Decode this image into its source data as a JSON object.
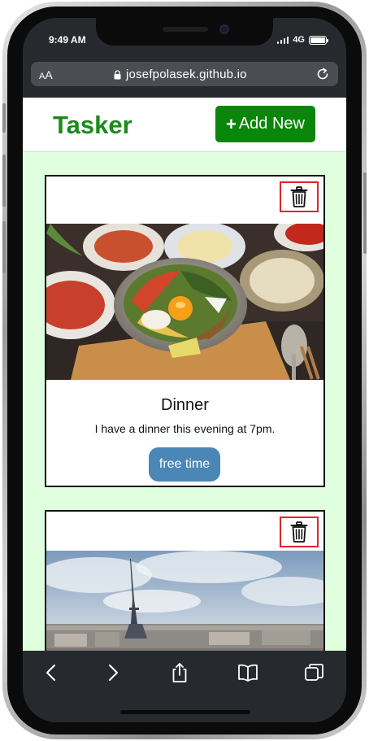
{
  "status_bar": {
    "time": "9:49 AM",
    "network": "4G",
    "battery_level": 1.0
  },
  "browser": {
    "text_size_label": "AA",
    "url": "josefpolasek.github.io"
  },
  "app": {
    "brand": "Tasker",
    "add_button": {
      "plus": "+",
      "label": "Add New"
    }
  },
  "tasks": [
    {
      "title": "Dinner",
      "description": "I have a dinner this evening at 7pm.",
      "tag": "free time",
      "image": "bibimbap-food-photo"
    },
    {
      "title": "",
      "description": "",
      "tag": "",
      "image": "eiffel-tower-paris-photo"
    }
  ],
  "toolbar": {
    "icons": [
      "back-icon",
      "forward-icon",
      "share-icon",
      "bookmarks-icon",
      "tabs-icon"
    ]
  },
  "colors": {
    "brand": "#1c8a1c",
    "add_button": "#0a870a",
    "page_background": "#dfffdf",
    "tag_button": "#4a86b6",
    "trash_border": "#e0242c"
  }
}
